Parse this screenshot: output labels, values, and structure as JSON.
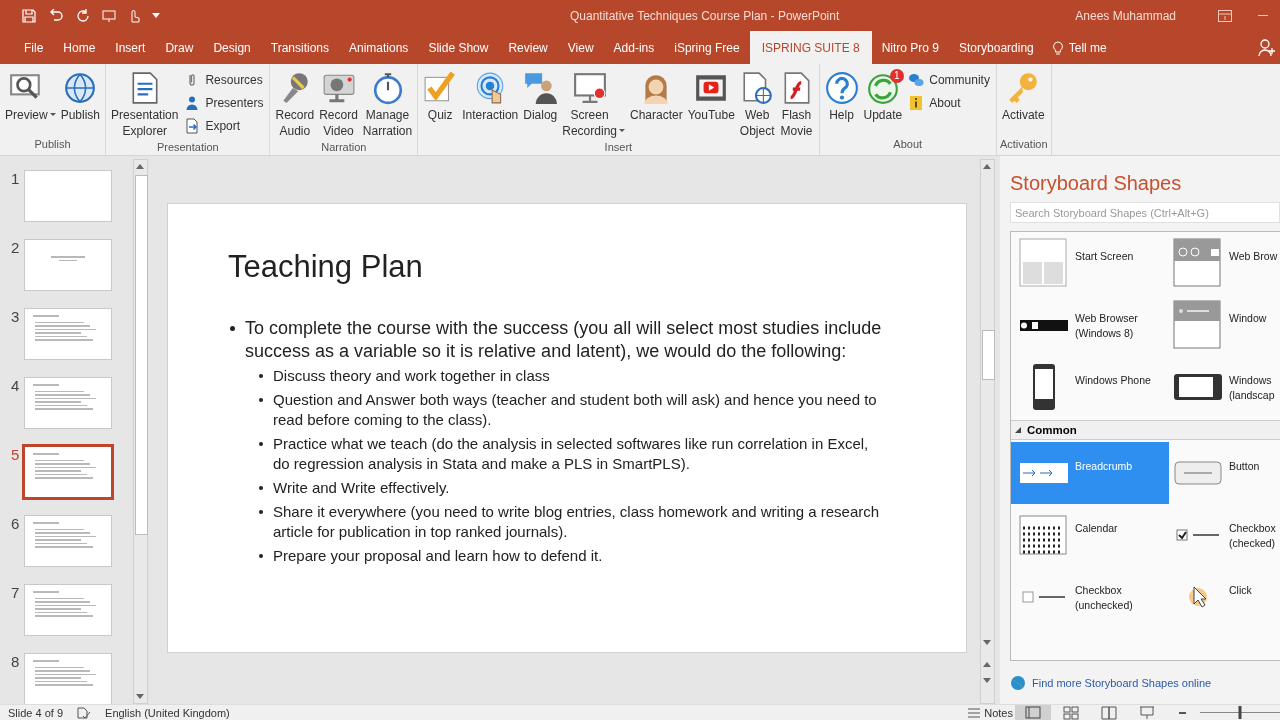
{
  "window": {
    "title": "Quantitative Techniques Course Plan - PowerPoint",
    "user": "Anees Muhammad"
  },
  "tabs": [
    {
      "label": "File",
      "selected": false
    },
    {
      "label": "Home",
      "selected": false
    },
    {
      "label": "Insert",
      "selected": false
    },
    {
      "label": "Draw",
      "selected": false
    },
    {
      "label": "Design",
      "selected": false
    },
    {
      "label": "Transitions",
      "selected": false
    },
    {
      "label": "Animations",
      "selected": false
    },
    {
      "label": "Slide Show",
      "selected": false
    },
    {
      "label": "Review",
      "selected": false
    },
    {
      "label": "View",
      "selected": false
    },
    {
      "label": "Add-ins",
      "selected": false
    },
    {
      "label": "iSpring Free",
      "selected": false
    },
    {
      "label": "ISPRING SUITE 8",
      "selected": true
    },
    {
      "label": "Nitro Pro 9",
      "selected": false
    },
    {
      "label": "Storyboarding",
      "selected": false
    }
  ],
  "tell_me": "Tell me",
  "ribbon_groups": [
    {
      "label": "Publish",
      "columns": [
        {
          "kind": "large",
          "buttons": [
            {
              "label": "Preview",
              "kind": "preview",
              "dropdown": true
            }
          ]
        },
        {
          "kind": "large",
          "buttons": [
            {
              "label": "Publish",
              "kind": "publish"
            }
          ]
        }
      ]
    },
    {
      "label": "Presentation",
      "columns": [
        {
          "kind": "large",
          "buttons": [
            {
              "label": "Presentation Explorer",
              "kind": "explorer"
            }
          ]
        },
        {
          "kind": "stack",
          "buttons": [
            {
              "label": "Resources",
              "kind": "resources"
            },
            {
              "label": "Presenters",
              "kind": "presenters"
            },
            {
              "label": "Export",
              "kind": "export"
            }
          ]
        }
      ]
    },
    {
      "label": "Narration",
      "columns": [
        {
          "kind": "large",
          "buttons": [
            {
              "label": "Record Audio",
              "kind": "mic"
            }
          ]
        },
        {
          "kind": "large",
          "buttons": [
            {
              "label": "Record Video",
              "kind": "camera"
            }
          ]
        },
        {
          "kind": "large",
          "buttons": [
            {
              "label": "Manage Narration",
              "kind": "stopwatch"
            }
          ]
        }
      ]
    },
    {
      "label": "Insert",
      "columns": [
        {
          "kind": "large",
          "buttons": [
            {
              "label": "Quiz",
              "kind": "quiz"
            }
          ]
        },
        {
          "kind": "large",
          "buttons": [
            {
              "label": "Interaction",
              "kind": "interaction"
            }
          ]
        },
        {
          "kind": "large",
          "buttons": [
            {
              "label": "Dialog",
              "kind": "dialog"
            }
          ]
        },
        {
          "kind": "large",
          "buttons": [
            {
              "label": "Screen Recording",
              "kind": "screen",
              "dropdown": true
            }
          ]
        },
        {
          "kind": "large",
          "buttons": [
            {
              "label": "Character",
              "kind": "character"
            }
          ]
        },
        {
          "kind": "large",
          "buttons": [
            {
              "label": "YouTube",
              "kind": "youtube"
            }
          ]
        },
        {
          "kind": "large",
          "buttons": [
            {
              "label": "Web Object",
              "kind": "webobject"
            }
          ]
        },
        {
          "kind": "large",
          "buttons": [
            {
              "label": "Flash Movie",
              "kind": "flash"
            }
          ]
        }
      ]
    },
    {
      "label": "About",
      "columns": [
        {
          "kind": "large",
          "buttons": [
            {
              "label": "Help",
              "kind": "help"
            }
          ]
        },
        {
          "kind": "large",
          "buttons": [
            {
              "label": "Update",
              "kind": "update",
              "badge": "1"
            }
          ]
        },
        {
          "kind": "stack",
          "buttons": [
            {
              "label": "Community",
              "kind": "community"
            },
            {
              "label": "About",
              "kind": "about"
            }
          ]
        }
      ]
    },
    {
      "label": "Activation",
      "columns": [
        {
          "kind": "large",
          "buttons": [
            {
              "label": "Activate",
              "kind": "key"
            }
          ]
        }
      ]
    }
  ],
  "thumbnails": [
    {
      "number": "1",
      "kind": "blank",
      "selected": false
    },
    {
      "number": "2",
      "kind": "title",
      "selected": false
    },
    {
      "number": "3",
      "kind": "text",
      "selected": false
    },
    {
      "number": "4",
      "kind": "text",
      "selected": false
    },
    {
      "number": "5",
      "kind": "text",
      "selected": true
    },
    {
      "number": "6",
      "kind": "text",
      "selected": false
    },
    {
      "number": "7",
      "kind": "text",
      "selected": false
    },
    {
      "number": "8",
      "kind": "text",
      "selected": false
    }
  ],
  "slide": {
    "title": "Teaching Plan",
    "bullets": [
      {
        "text": "To complete the course with the success (you all will select most studies include success as a variable so it is relative and latent), we would do the following:",
        "children": [
          {
            "text": "Discuss theory and work together in class"
          },
          {
            "text": "Question and Answer both ways (teacher and student both will ask) and hence you need to read before coming to the class)."
          },
          {
            "text": "Practice what we teach (do the analysis in selected softwares like run correlation in Excel, do regression analysis in Stata and make a PLS in SmartPLS)."
          },
          {
            "text": "Write and Write effectively."
          },
          {
            "text": "Share it everywhere (you need to write blog entries, class homework and writing a research article for publication in top ranked journals)."
          },
          {
            "text": "Prepare your proposal and learn how to defend it."
          }
        ]
      }
    ]
  },
  "storyboard": {
    "title": "Storyboard Shapes",
    "search_placeholder": "Search Storyboard Shapes (Ctrl+Alt+G)",
    "sections": [
      {
        "items": [
          {
            "label": "Start Screen",
            "kind": "start",
            "selected": false
          },
          {
            "label": "Web Brow",
            "kind": "browser",
            "selected": false
          },
          {
            "label": "Web Browser (Windows 8)",
            "kind": "browser8",
            "selected": false
          },
          {
            "label": "Window",
            "kind": "window",
            "selected": false
          },
          {
            "label": "Windows Phone",
            "kind": "phone",
            "selected": false
          },
          {
            "label": "Windows (landscap",
            "kind": "tablet",
            "selected": false
          }
        ]
      },
      {
        "title": "Common",
        "expanded": true,
        "items": [
          {
            "label": "Breadcrumb",
            "kind": "breadcrumb",
            "selected": true
          },
          {
            "label": "Button",
            "kind": "button",
            "selected": false
          },
          {
            "label": "Calendar",
            "kind": "calendar",
            "selected": false
          },
          {
            "label": "Checkbox (checked)",
            "kind": "checked",
            "selected": false
          },
          {
            "label": "Checkbox (unchecked)",
            "kind": "unchecked",
            "selected": false
          },
          {
            "label": "Click",
            "kind": "click",
            "selected": false
          }
        ]
      }
    ],
    "link": "Find more Storyboard Shapes online"
  },
  "status_bar": {
    "slide": "Slide 4 of 9",
    "language": "English (United Kingdom)",
    "notes": "Notes",
    "zoom_slider": {
      "level": 0.5
    }
  }
}
